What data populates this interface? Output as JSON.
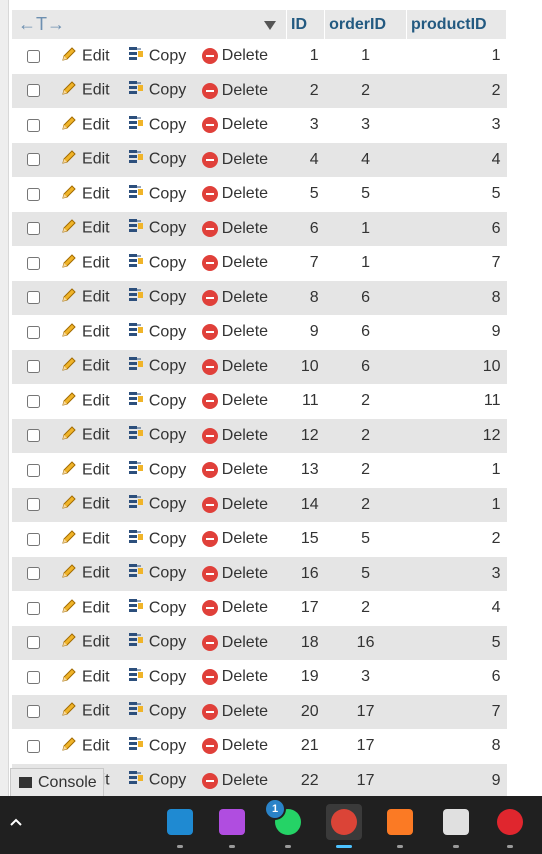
{
  "header": {
    "arrows_label": "←T→",
    "columns": [
      "ID",
      "orderID",
      "productID"
    ]
  },
  "actions": {
    "edit_label": "Edit",
    "copy_label": "Copy",
    "delete_label": "Delete"
  },
  "rows": [
    {
      "id": "1",
      "orderID": "1",
      "productID": "1"
    },
    {
      "id": "2",
      "orderID": "2",
      "productID": "2"
    },
    {
      "id": "3",
      "orderID": "3",
      "productID": "3"
    },
    {
      "id": "4",
      "orderID": "4",
      "productID": "4"
    },
    {
      "id": "5",
      "orderID": "5",
      "productID": "5"
    },
    {
      "id": "6",
      "orderID": "1",
      "productID": "6"
    },
    {
      "id": "7",
      "orderID": "1",
      "productID": "7"
    },
    {
      "id": "8",
      "orderID": "6",
      "productID": "8"
    },
    {
      "id": "9",
      "orderID": "6",
      "productID": "9"
    },
    {
      "id": "10",
      "orderID": "6",
      "productID": "10"
    },
    {
      "id": "11",
      "orderID": "2",
      "productID": "11"
    },
    {
      "id": "12",
      "orderID": "2",
      "productID": "12"
    },
    {
      "id": "13",
      "orderID": "2",
      "productID": "1"
    },
    {
      "id": "14",
      "orderID": "2",
      "productID": "1"
    },
    {
      "id": "15",
      "orderID": "5",
      "productID": "2"
    },
    {
      "id": "16",
      "orderID": "5",
      "productID": "3"
    },
    {
      "id": "17",
      "orderID": "2",
      "productID": "4"
    },
    {
      "id": "18",
      "orderID": "16",
      "productID": "5"
    },
    {
      "id": "19",
      "orderID": "3",
      "productID": "6"
    },
    {
      "id": "20",
      "orderID": "17",
      "productID": "7"
    },
    {
      "id": "21",
      "orderID": "17",
      "productID": "8"
    },
    {
      "id": "22",
      "orderID": "17",
      "productID": "9"
    }
  ],
  "console": {
    "label": "Console"
  },
  "taskbar": {
    "apps": [
      {
        "name": "vscode-icon",
        "color": "#1f8ad2"
      },
      {
        "name": "phpstorm-icon",
        "color": "#b04de0"
      },
      {
        "name": "whatsapp-icon",
        "color": "#25d366",
        "badge": "1"
      },
      {
        "name": "chrome-icon",
        "color": "#db4437"
      },
      {
        "name": "xampp-icon",
        "color": "#fb7a24"
      },
      {
        "name": "snipping-tool-icon",
        "color": "#e0e0e0"
      },
      {
        "name": "opera-icon",
        "color": "#e0262e"
      }
    ]
  },
  "colors": {
    "link": "#235a81",
    "row_even": "#e5e5e5",
    "header_bg": "#e8e8e8",
    "delete": "#e0403a",
    "taskbar": "#202020"
  }
}
